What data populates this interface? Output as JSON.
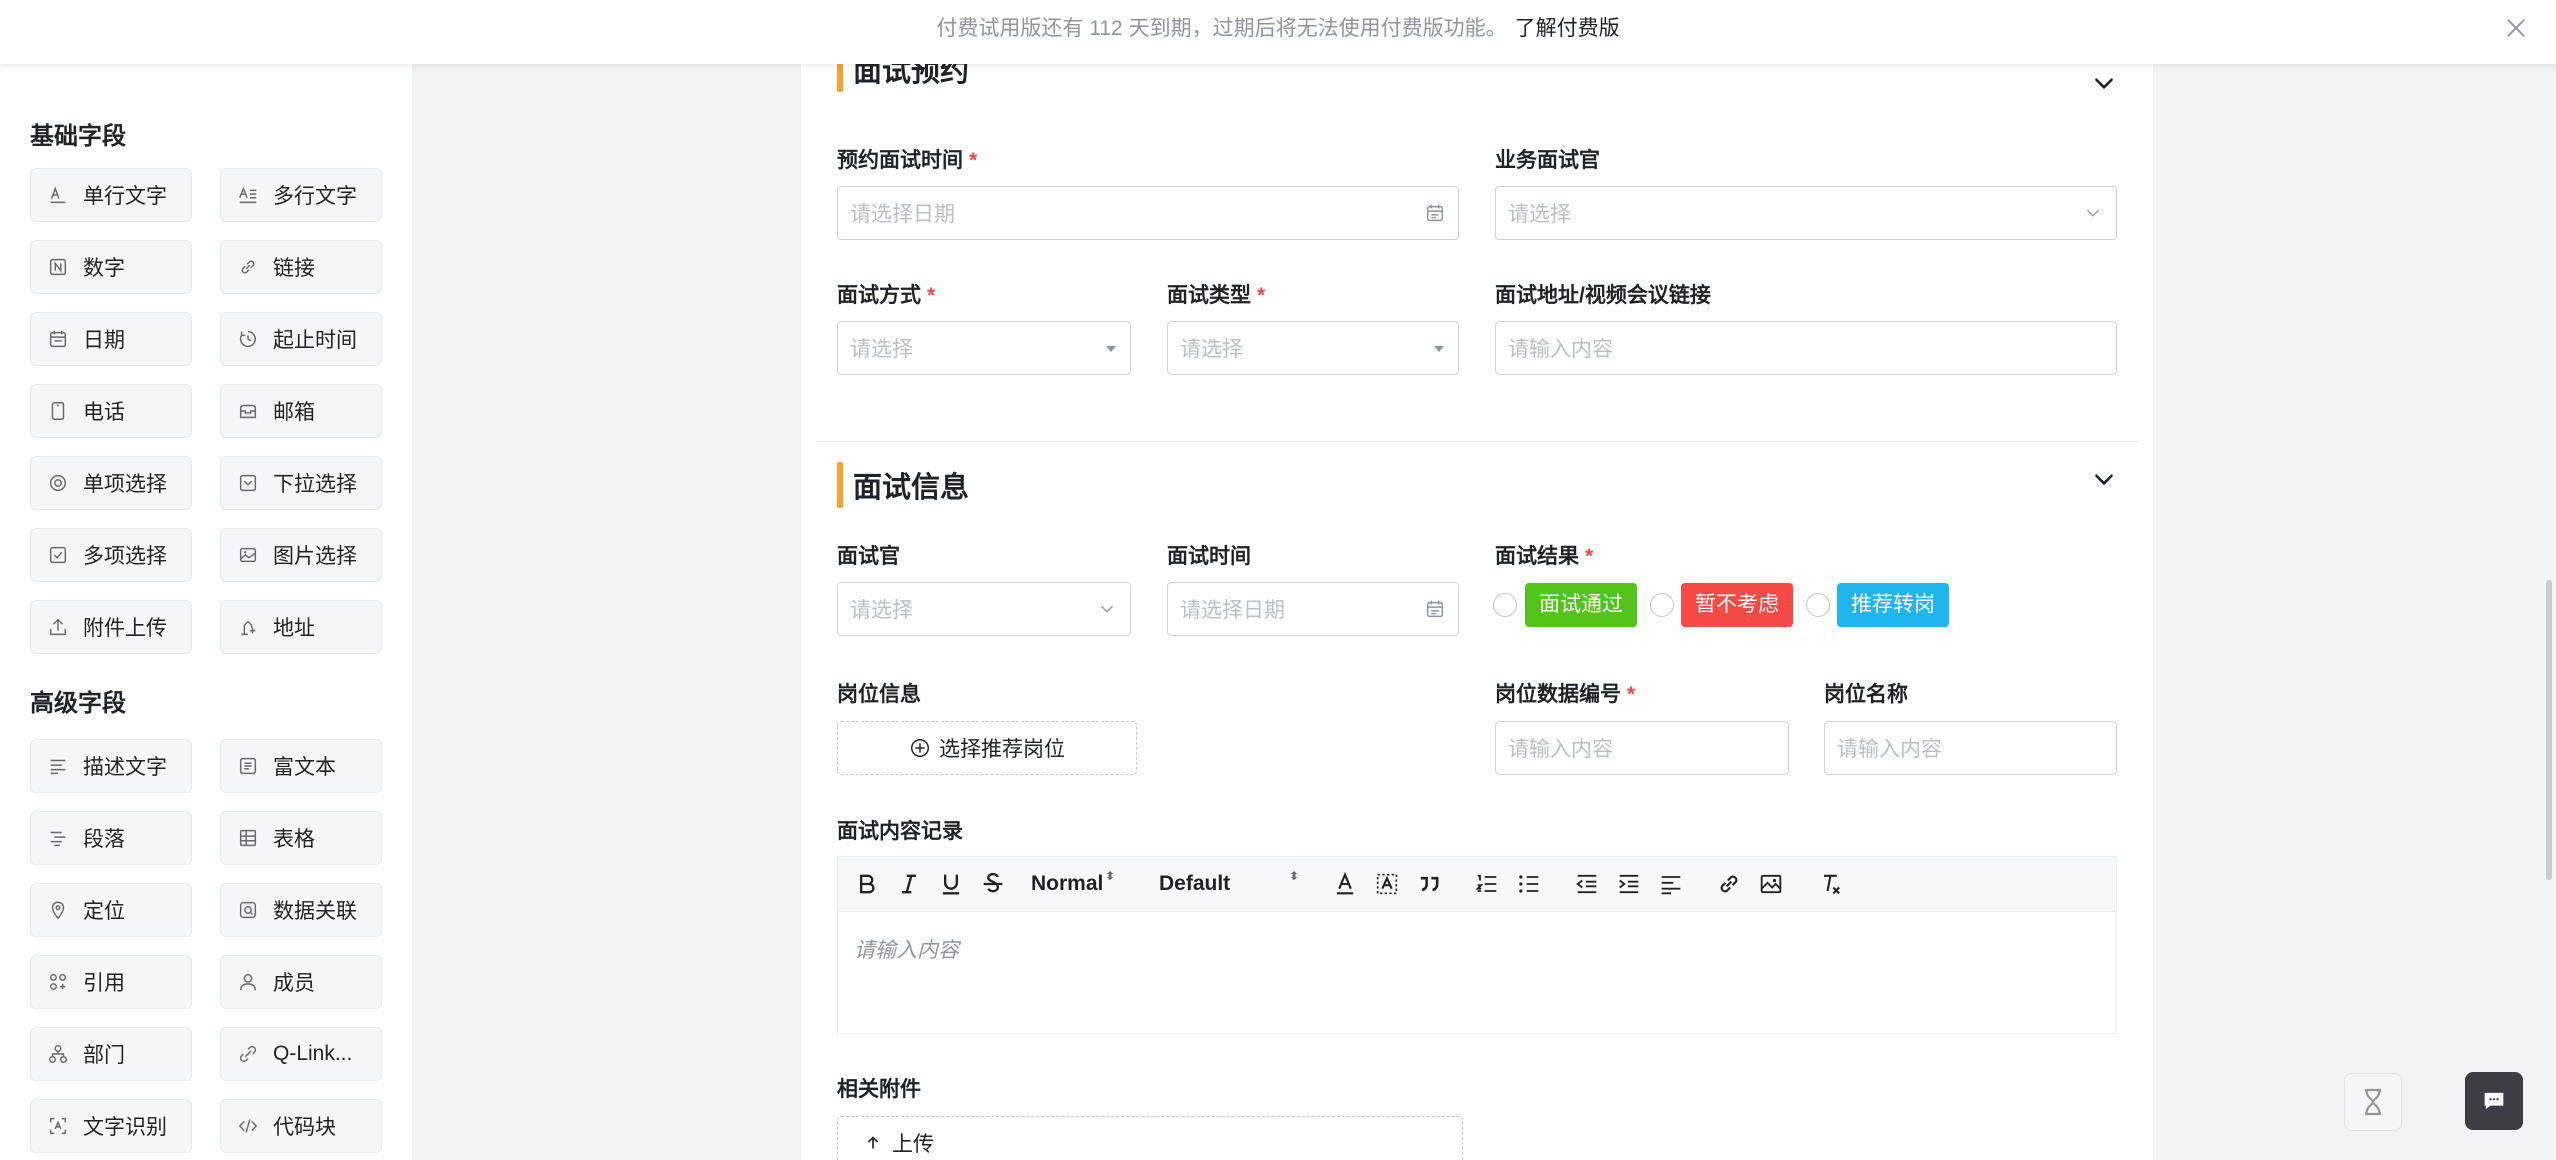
{
  "banner": {
    "message": "付费试用版还有 112 天到期，过期后将无法使用付费版功能。",
    "link": "了解付费版"
  },
  "sidebar": {
    "basic_title": "基础字段",
    "basic_fields": [
      {
        "label": "单行文字",
        "icon": "single-line-text-icon"
      },
      {
        "label": "多行文字",
        "icon": "multi-line-text-icon"
      },
      {
        "label": "数字",
        "icon": "number-icon"
      },
      {
        "label": "链接",
        "icon": "link-icon"
      },
      {
        "label": "日期",
        "icon": "calendar-icon"
      },
      {
        "label": "起止时间",
        "icon": "time-range-icon"
      },
      {
        "label": "电话",
        "icon": "phone-icon"
      },
      {
        "label": "邮箱",
        "icon": "mailbox-icon"
      },
      {
        "label": "单项选择",
        "icon": "radio-icon"
      },
      {
        "label": "下拉选择",
        "icon": "dropdown-icon"
      },
      {
        "label": "多项选择",
        "icon": "checkbox-icon"
      },
      {
        "label": "图片选择",
        "icon": "image-icon"
      },
      {
        "label": "附件上传",
        "icon": "upload-icon"
      },
      {
        "label": "地址",
        "icon": "address-icon"
      }
    ],
    "advanced_title": "高级字段",
    "advanced_fields": [
      {
        "label": "描述文字",
        "icon": "description-icon"
      },
      {
        "label": "富文本",
        "icon": "rich-text-icon"
      },
      {
        "label": "段落",
        "icon": "paragraph-icon"
      },
      {
        "label": "表格",
        "icon": "table-icon"
      },
      {
        "label": "定位",
        "icon": "location-icon"
      },
      {
        "label": "数据关联",
        "icon": "data-link-icon"
      },
      {
        "label": "引用",
        "icon": "reference-icon"
      },
      {
        "label": "成员",
        "icon": "member-icon"
      },
      {
        "label": "部门",
        "icon": "department-icon"
      },
      {
        "label": "Q-Link...",
        "icon": "q-link-icon"
      },
      {
        "label": "文字识别",
        "icon": "ocr-icon"
      },
      {
        "label": "代码块",
        "icon": "code-block-icon"
      }
    ]
  },
  "form": {
    "appointment": {
      "title": "面试预约",
      "time_label": "预约面试时间",
      "time_placeholder": "请选择日期",
      "business_interviewer_label": "业务面试官",
      "business_interviewer_placeholder": "请选择",
      "method_label": "面试方式",
      "method_placeholder": "请选择",
      "type_label": "面试类型",
      "type_placeholder": "请选择",
      "address_label": "面试地址/视频会议链接",
      "address_placeholder": "请输入内容"
    },
    "info": {
      "title": "面试信息",
      "interviewer_label": "面试官",
      "interviewer_placeholder": "请选择",
      "time_label": "面试时间",
      "time_placeholder": "请选择日期",
      "result_label": "面试结果",
      "results": [
        {
          "label": "面试通过",
          "color": "#52c41a"
        },
        {
          "label": "暂不考虑",
          "color": "#f54a45"
        },
        {
          "label": "推荐转岗",
          "color": "#1fb6f0"
        }
      ],
      "position_info_label": "岗位信息",
      "select_position_button": "选择推荐岗位",
      "position_code_label": "岗位数据编号",
      "position_code_placeholder": "请输入内容",
      "position_name_label": "岗位名称",
      "position_name_placeholder": "请输入内容",
      "record_label": "面试内容记录",
      "editor": {
        "header_select": "Normal",
        "font_select": "Default",
        "placeholder": "请输入内容"
      },
      "attachments_label": "相关附件",
      "upload_button": "上传"
    }
  },
  "colors": {
    "accent": "#f7a12e",
    "required": "#f54a45"
  }
}
